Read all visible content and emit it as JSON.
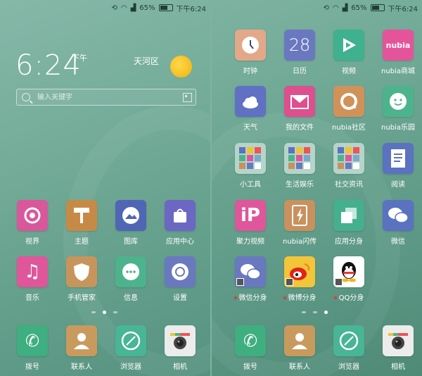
{
  "status": {
    "battery": "65%",
    "time": "下午6:24",
    "battery_level": 0.65
  },
  "left": {
    "clock_time": "6:24",
    "ampm": "下午",
    "city": "天河区",
    "search_placeholder": "输入关键字",
    "apps_row1": [
      {
        "label": "视界",
        "color": "#d8589b",
        "icon": "eye-icon"
      },
      {
        "label": "主题",
        "color": "#c78a46",
        "icon": "theme-icon"
      },
      {
        "label": "图库",
        "color": "#5066b4",
        "icon": "gallery-icon"
      },
      {
        "label": "应用中心",
        "color": "#6d67c4",
        "icon": "store-icon"
      }
    ],
    "apps_row2": [
      {
        "label": "音乐",
        "color": "#e0569b",
        "icon": "music-icon"
      },
      {
        "label": "手机管家",
        "color": "#c7955c",
        "icon": "shield-icon"
      },
      {
        "label": "信息",
        "color": "#4db38c",
        "icon": "message-icon"
      },
      {
        "label": "设置",
        "color": "#6a78c0",
        "icon": "settings-icon"
      }
    ],
    "dock": [
      {
        "label": "拨号",
        "color": "#3fae80",
        "icon": "phone-icon"
      },
      {
        "label": "联系人",
        "color": "#c99a5e",
        "icon": "contacts-icon"
      },
      {
        "label": "浏览器",
        "color": "#48b595",
        "icon": "browser-icon"
      },
      {
        "label": "相机",
        "color": "#ececec",
        "icon": "camera-icon"
      }
    ]
  },
  "right": {
    "calendar_day": "28",
    "rows": [
      [
        {
          "label": "时钟",
          "color": "#e3a889",
          "icon": "clock-icon"
        },
        {
          "label": "日历",
          "color": "#6a78c0",
          "icon": "calendar-icon"
        },
        {
          "label": "视频",
          "color": "#3fb18e",
          "icon": "play-icon"
        },
        {
          "label": "nubia商城",
          "color": "#e5549a",
          "icon": "nubia-icon"
        }
      ],
      [
        {
          "label": "天气",
          "color": "#6070c2",
          "icon": "weather-icon"
        },
        {
          "label": "我的文件",
          "color": "#dd4f8e",
          "icon": "folder-icon"
        },
        {
          "label": "nubia社区",
          "color": "#d1925a",
          "icon": "community-icon"
        },
        {
          "label": "nubia乐园",
          "color": "#4db38c",
          "icon": "chat-icon"
        }
      ],
      [
        {
          "label": "小工具",
          "color": "#b5d4ca",
          "icon": "folder-grid-icon"
        },
        {
          "label": "生活娱乐",
          "color": "#b5d4ca",
          "icon": "folder-grid-icon"
        },
        {
          "label": "社交资讯",
          "color": "#b5d4ca",
          "icon": "folder-grid-icon"
        },
        {
          "label": "阅读",
          "color": "#5a72c0",
          "icon": "document-icon"
        }
      ],
      [
        {
          "label": "聚力视频",
          "color": "#e0569b",
          "icon": "pptv-icon"
        },
        {
          "label": "nubia闪传",
          "color": "#c9915e",
          "icon": "flash-icon"
        },
        {
          "label": "应用分身",
          "color": "#45b08d",
          "icon": "clone-icon"
        },
        {
          "label": "微信",
          "color": "#5a72c0",
          "icon": "wechat-icon"
        }
      ],
      [
        {
          "label": "微信分身",
          "color": "#6a78c0",
          "icon": "wechat-icon",
          "clone": true
        },
        {
          "label": "微博分身",
          "color": "#f3c538",
          "icon": "weibo-icon",
          "clone": true
        },
        {
          "label": "QQ分身",
          "color": "#ffffff",
          "icon": "qq-icon",
          "clone": true
        }
      ]
    ],
    "dock": [
      {
        "label": "拨号",
        "color": "#3fae80",
        "icon": "phone-icon"
      },
      {
        "label": "联系人",
        "color": "#c99a5e",
        "icon": "contacts-icon"
      },
      {
        "label": "浏览器",
        "color": "#48b595",
        "icon": "browser-icon"
      },
      {
        "label": "相机",
        "color": "#ececec",
        "icon": "camera-icon"
      }
    ]
  }
}
